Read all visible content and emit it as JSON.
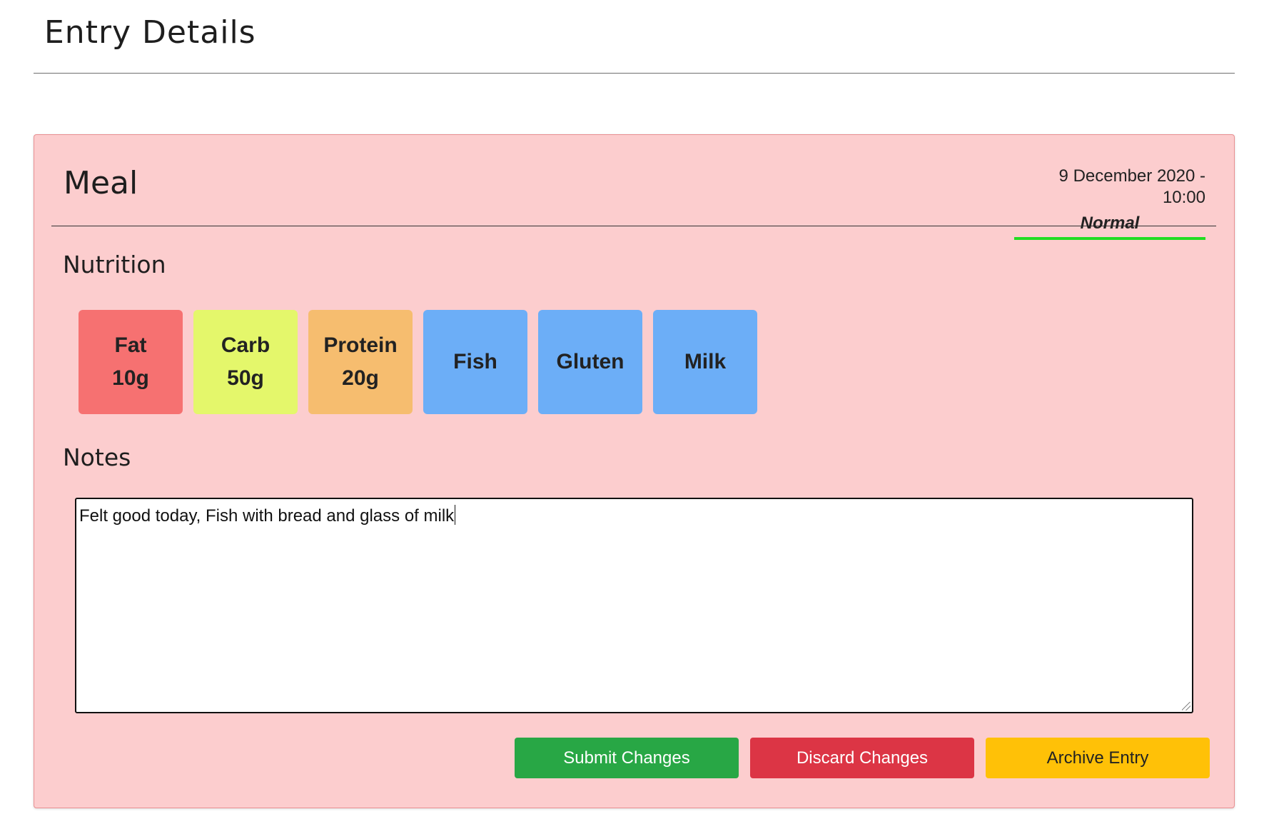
{
  "page": {
    "title": "Entry Details"
  },
  "entry": {
    "type": "Meal",
    "datetime": "9 December 2020 - 10:00",
    "status": "Normal",
    "status_color": "#22dd22",
    "card_color": "#fccdce"
  },
  "nutrition": {
    "title": "Nutrition",
    "tiles": [
      {
        "label": "Fat",
        "value": "10g",
        "color": "#f67171"
      },
      {
        "label": "Carb",
        "value": "50g",
        "color": "#e4f76b"
      },
      {
        "label": "Protein",
        "value": "20g",
        "color": "#f6bd6f"
      },
      {
        "label": "Fish",
        "value": "",
        "color": "#6caef7"
      },
      {
        "label": "Gluten",
        "value": "",
        "color": "#6caef7"
      },
      {
        "label": "Milk",
        "value": "",
        "color": "#6caef7"
      }
    ]
  },
  "notes": {
    "title": "Notes",
    "value": "Felt good today, Fish with bread and glass of milk"
  },
  "actions": {
    "submit_label": "Submit Changes",
    "discard_label": "Discard Changes",
    "archive_label": "Archive Entry",
    "submit_color": "#28a745",
    "discard_color": "#dc3545",
    "archive_color": "#ffc107"
  }
}
